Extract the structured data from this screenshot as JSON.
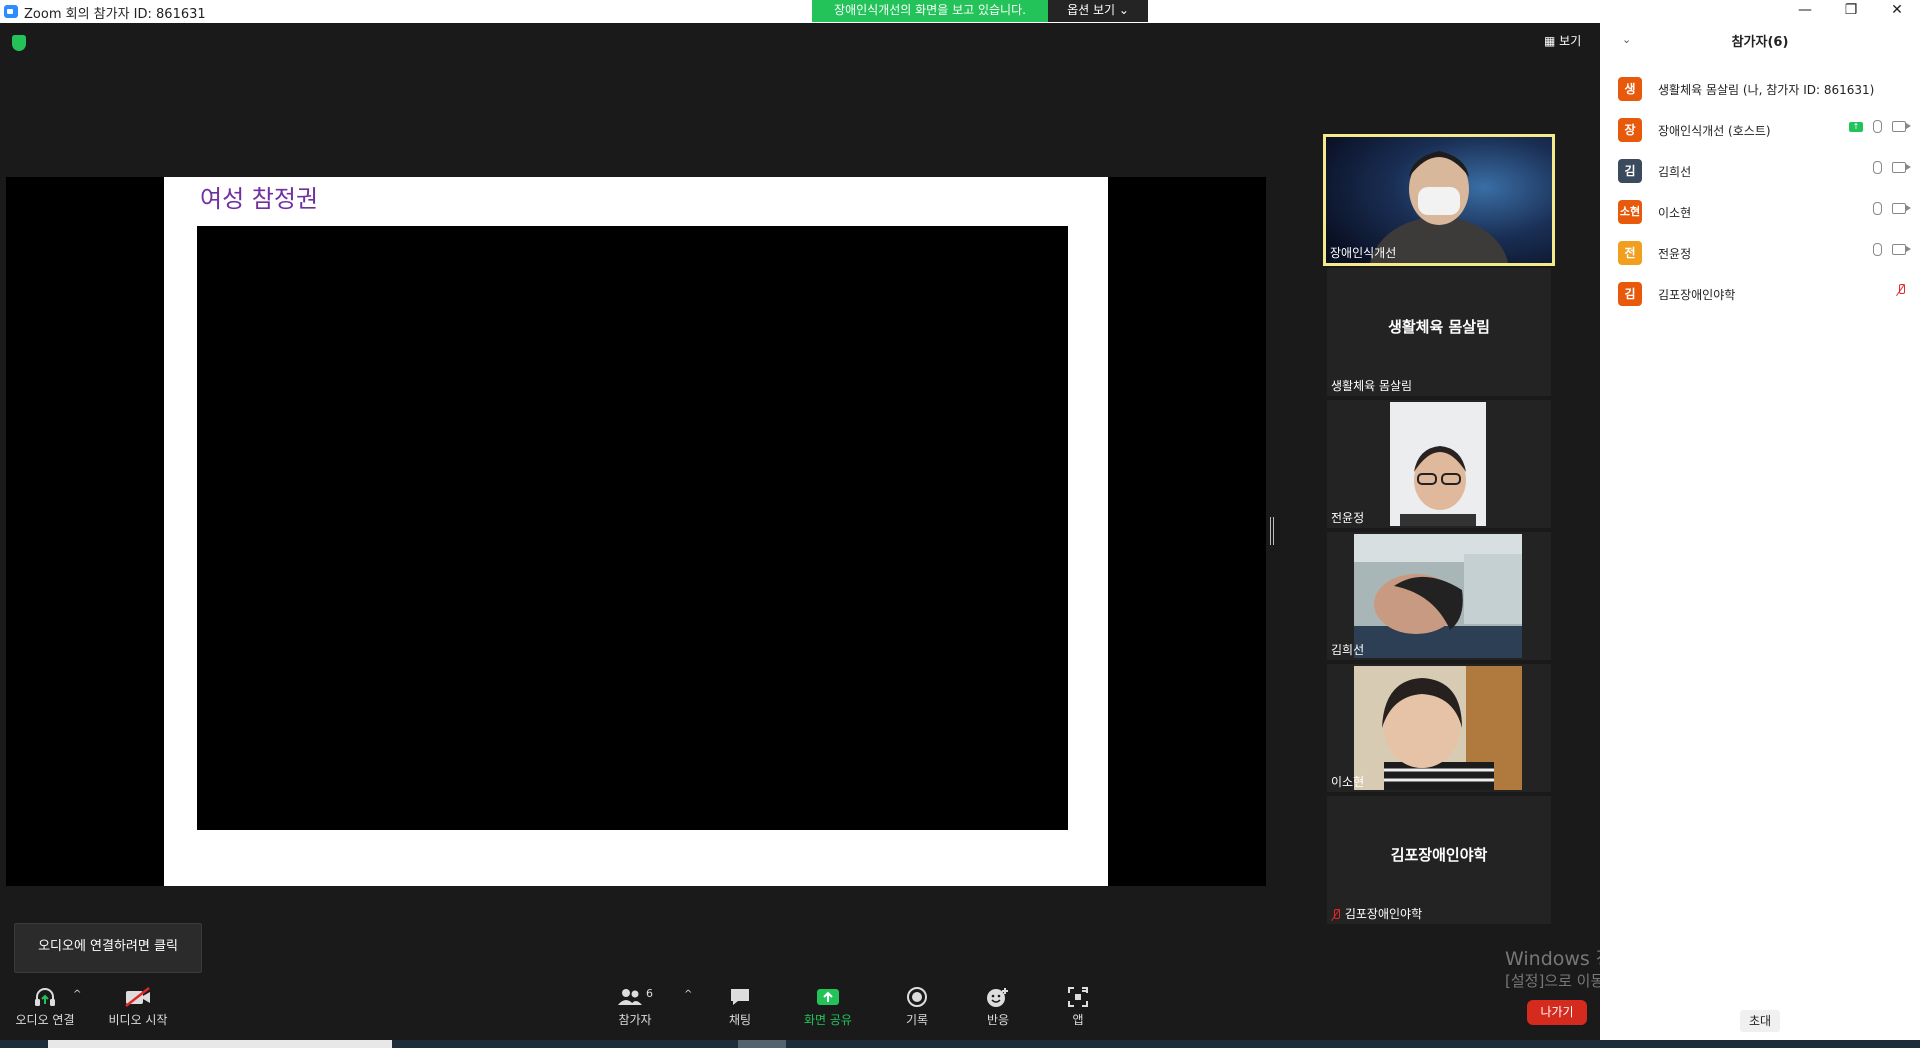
{
  "window": {
    "title": "Zoom 회의 참가자 ID: 861631",
    "controls": {
      "minimize": "—",
      "maximize": "❐",
      "close": "✕"
    }
  },
  "share_banner": {
    "text": "장애인식개선의 화면을 보고 있습니다.",
    "options": "옵션 보기 ⌄"
  },
  "stage": {
    "view_label": "보기",
    "slide_title": "여성 참정권"
  },
  "tiles": {
    "active": {
      "name": "장애인식개선"
    },
    "t2": {
      "center_name": "생활체육 몸살림",
      "name": "생활체육 몸살림"
    },
    "t3": {
      "name": "전윤정"
    },
    "t4": {
      "name": "김희선"
    },
    "t5": {
      "name": "이소현"
    },
    "t6": {
      "center_name": "김포장애인야학",
      "name": "김포장애인야학"
    }
  },
  "tooltip": "오디오에 연결하려면 클릭",
  "toolbar": {
    "audio": "오디오 연결",
    "video": "비디오 시작",
    "participants": "참가자",
    "participants_count": "6",
    "chat": "채팅",
    "share": "화면 공유",
    "record": "기록",
    "reactions": "반응",
    "apps": "앱",
    "leave": "나가기"
  },
  "watermark": {
    "line1": "Windows 정품 인증",
    "line2": "[설정]으로 이동하여 Windows를 정품 인증합니다."
  },
  "panel": {
    "title": "참가자(6)",
    "invite": "초대",
    "participants": [
      {
        "initial": "생",
        "name": "생활체육 몸살림 (나, 참가자 ID: 861631)",
        "color": "#e8590c"
      },
      {
        "initial": "장",
        "name": "장애인식개선 (호스트)",
        "color": "#e8590c"
      },
      {
        "initial": "김",
        "name": "김희선",
        "color": "#3b4a5c"
      },
      {
        "initial": "소현",
        "name": "이소현",
        "color": "#e8590c"
      },
      {
        "initial": "전",
        "name": "전윤정",
        "color": "#f0a01e"
      },
      {
        "initial": "김",
        "name": "김포장애인야학",
        "color": "#e8590c"
      }
    ]
  }
}
